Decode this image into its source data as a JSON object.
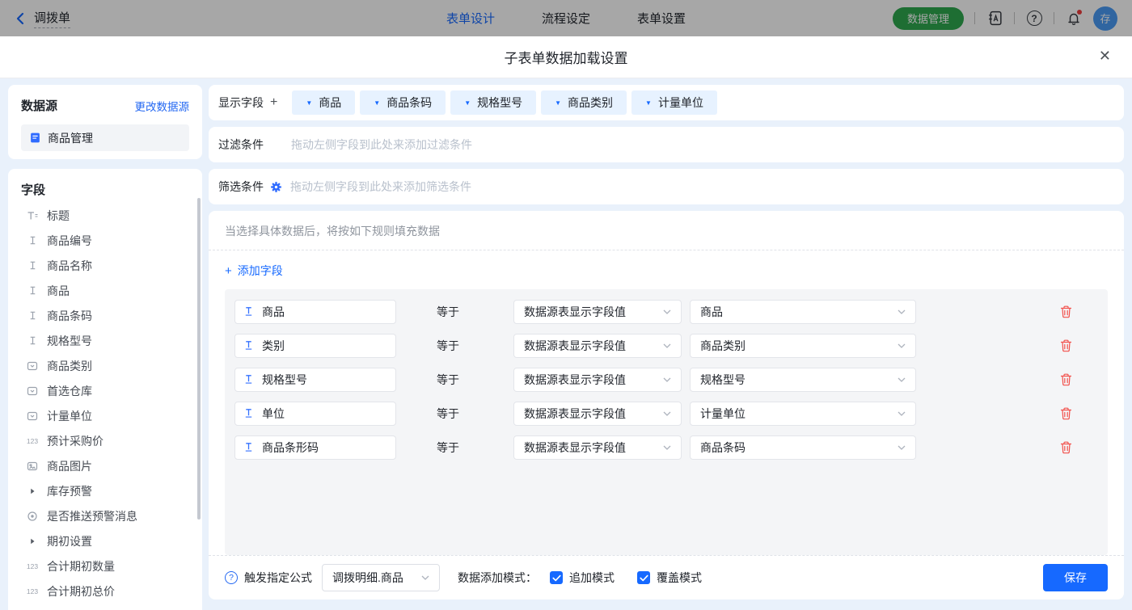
{
  "colors": {
    "accent": "#1669ff",
    "green": "#2fa84f",
    "danger": "#f2504b",
    "tag_bg": "#e7f2ff"
  },
  "topbar": {
    "back_label": "调拨单",
    "tabs": [
      {
        "label": "表单设计",
        "active": true
      },
      {
        "label": "流程设定",
        "active": false
      },
      {
        "label": "表单设置",
        "active": false
      }
    ],
    "data_manage_label": "数据管理",
    "help_mark": "?",
    "avatar_text": "存"
  },
  "modal": {
    "title": "子表单数据加载设置",
    "close_label": "✕",
    "datasource": {
      "title": "数据源",
      "change_link": "更改数据源",
      "items": [
        {
          "label": "商品管理"
        }
      ]
    },
    "fields_panel": {
      "title": "字段",
      "items": [
        {
          "label": "标题",
          "type": "title"
        },
        {
          "label": "商品编号",
          "type": "text"
        },
        {
          "label": "商品名称",
          "type": "text"
        },
        {
          "label": "商品",
          "type": "text"
        },
        {
          "label": "商品条码",
          "type": "text"
        },
        {
          "label": "规格型号",
          "type": "text"
        },
        {
          "label": "商品类别",
          "type": "select"
        },
        {
          "label": "首选仓库",
          "type": "select"
        },
        {
          "label": "计量单位",
          "type": "select"
        },
        {
          "label": "预计采购价",
          "type": "number",
          "icon_text": "123"
        },
        {
          "label": "商品图片",
          "type": "image"
        },
        {
          "label": "库存预警",
          "type": "group"
        },
        {
          "label": "是否推送预警消息",
          "type": "radio"
        },
        {
          "label": "期初设置",
          "type": "group"
        },
        {
          "label": "合计期初数量",
          "type": "number",
          "icon_text": "123"
        },
        {
          "label": "合计期初总价",
          "type": "number",
          "icon_text": "123"
        }
      ]
    },
    "display_fields": {
      "label": "显示字段",
      "add_symbol": "+",
      "tags": [
        "商品",
        "商品条码",
        "规格型号",
        "商品类别",
        "计量单位"
      ]
    },
    "filter": {
      "label": "过滤条件",
      "placeholder": "拖动左侧字段到此处来添加过滤条件"
    },
    "screen": {
      "label": "筛选条件",
      "placeholder": "拖动左侧字段到此处来添加筛选条件"
    },
    "rules": {
      "hint": "当选择具体数据后，将按如下规则填充数据",
      "add_symbol": "+",
      "add_field_label": "添加字段",
      "rows": [
        {
          "field": "商品",
          "operator": "等于",
          "source": "数据源表显示字段值",
          "value": "商品"
        },
        {
          "field": "类别",
          "operator": "等于",
          "source": "数据源表显示字段值",
          "value": "商品类别"
        },
        {
          "field": "规格型号",
          "operator": "等于",
          "source": "数据源表显示字段值",
          "value": "规格型号"
        },
        {
          "field": "单位",
          "operator": "等于",
          "source": "数据源表显示字段值",
          "value": "计量单位"
        },
        {
          "field": "商品条形码",
          "operator": "等于",
          "source": "数据源表显示字段值",
          "value": "商品条码"
        }
      ]
    },
    "footer": {
      "help_mark": "?",
      "formula_label": "触发指定公式",
      "formula_value": "调拨明细.商品",
      "mode_label": "数据添加模式：",
      "checkboxes": [
        {
          "label": "追加模式",
          "checked": true
        },
        {
          "label": "覆盖模式",
          "checked": true
        }
      ],
      "save_label": "保存"
    }
  }
}
